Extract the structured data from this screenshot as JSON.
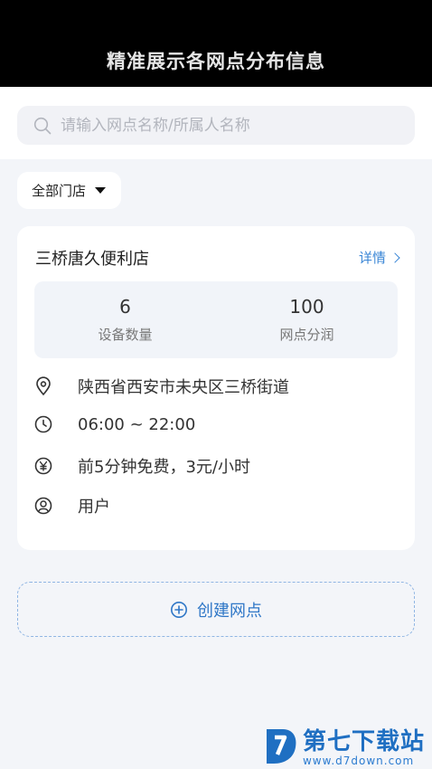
{
  "banner": {
    "title": "精准展示各网点分布信息"
  },
  "search": {
    "placeholder": "请输入网点名称/所属人名称"
  },
  "filter": {
    "label": "全部门店"
  },
  "store": {
    "name": "三桥唐久便利店",
    "detail_label": "详情",
    "stats": [
      {
        "value": "6",
        "label": "设备数量"
      },
      {
        "value": "100",
        "label": "网点分润"
      }
    ],
    "address": "陕西省西安市未央区三桥街道",
    "hours": "06:00 ~ 22:00",
    "pricing": "前5分钟免费，3元/小时",
    "owner": "用户"
  },
  "create": {
    "label": "创建网点"
  },
  "watermark": {
    "name": "第七下载站",
    "url": "www.d7down.com"
  },
  "colors": {
    "accent": "#2f77c7",
    "link": "#3a86d6",
    "banner_bg": "#000000"
  }
}
